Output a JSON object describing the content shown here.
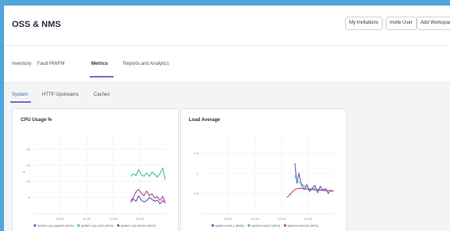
{
  "header": {
    "title": "OSS & NMS",
    "buttons": [
      "My Invitations",
      "Invite User",
      "Add Workspace"
    ]
  },
  "nav": {
    "tabs": [
      "Inventory",
      "Fault PM/FM",
      "Metrics",
      "Reports and Analytics"
    ],
    "active": "Metrics"
  },
  "subnav": {
    "tabs": [
      "System",
      "HTTP Upstreams",
      "Caches"
    ],
    "active": "System"
  },
  "colors": {
    "blue": "#5b5fc7",
    "teal": "#4bbf9f",
    "magenta": "#b4458c",
    "accent": "#6b6fd3",
    "background": "#4fa6d8"
  },
  "chart_data": [
    {
      "type": "line",
      "title": "CPU Usage %",
      "ylabel": "%",
      "ylim": [
        0,
        25
      ],
      "yticks": [
        5,
        10,
        15,
        20
      ],
      "xticks": [
        "10:00",
        "11:20",
        "12:40",
        "14:13"
      ],
      "xlim": [
        0,
        100
      ],
      "series": [
        {
          "name": "system.cpu.system (AVG)",
          "color": "#5b5fc7",
          "x": [
            73,
            75,
            77,
            79,
            81,
            83,
            85,
            87,
            89,
            91,
            93,
            95,
            97,
            99
          ],
          "values": [
            3.5,
            4.5,
            3.8,
            5.5,
            4.2,
            3.6,
            4.0,
            5.0,
            4.4,
            3.8,
            4.2,
            3.0,
            4.0,
            3.4
          ]
        },
        {
          "name": "system.cpu.user (AVG)",
          "color": "#4bbf9f",
          "x": [
            73,
            75,
            77,
            79,
            81,
            83,
            85,
            87,
            89,
            91,
            93,
            95,
            97,
            99
          ],
          "values": [
            11.5,
            12.3,
            11.8,
            13.6,
            12.0,
            11.6,
            12.6,
            11.5,
            12.9,
            12.2,
            11.3,
            12.4,
            14.1,
            10.5
          ]
        },
        {
          "name": "system.cpu.stolen (AVG)",
          "color": "#b4458c",
          "x": [
            73,
            75,
            77,
            79,
            81,
            83,
            85,
            87,
            89,
            91,
            93,
            95,
            97,
            99
          ],
          "values": [
            4.0,
            5.0,
            6.8,
            7.5,
            6.2,
            5.5,
            7.0,
            5.6,
            6.1,
            4.8,
            5.3,
            4.1,
            5.4,
            3.2
          ]
        }
      ]
    },
    {
      "type": "line",
      "title": "Load Average",
      "ylim": [
        0,
        2
      ],
      "yticks": [
        0.5,
        1,
        1.5
      ],
      "xticks": [
        "10:00",
        "11:20",
        "12:40",
        "14:13"
      ],
      "xlim": [
        0,
        100
      ],
      "series": [
        {
          "name": "system.load.1 (AVG)",
          "color": "#5b5fc7",
          "x": [
            70,
            71.5,
            73,
            75,
            77,
            79,
            81,
            83,
            85,
            87,
            89,
            91,
            93,
            95,
            97,
            99
          ],
          "values": [
            1.25,
            0.75,
            1.0,
            0.7,
            0.6,
            0.72,
            0.55,
            0.63,
            0.7,
            0.52,
            0.68,
            0.58,
            0.62,
            0.5,
            0.58,
            0.55
          ]
        },
        {
          "name": "system.load.5 (AVG)",
          "color": "#4bbf9f",
          "x": [
            70,
            71.5,
            73,
            75,
            77,
            79,
            81,
            83,
            85,
            87,
            89,
            91,
            93,
            95,
            97,
            99
          ],
          "values": [
            0.95,
            0.82,
            0.78,
            0.74,
            0.68,
            0.65,
            0.62,
            0.61,
            0.62,
            0.6,
            0.59,
            0.58,
            0.58,
            0.57,
            0.56,
            0.56
          ]
        },
        {
          "name": "system.load.15 (AVG)",
          "color": "#b4458c",
          "x": [
            64,
            66,
            68,
            70,
            72,
            74,
            76,
            78,
            80,
            82,
            84,
            86,
            88,
            90,
            92,
            95,
            99
          ],
          "values": [
            0.4,
            0.46,
            0.54,
            0.6,
            0.62,
            0.63,
            0.62,
            0.61,
            0.6,
            0.6,
            0.59,
            0.59,
            0.58,
            0.58,
            0.57,
            0.57,
            0.56
          ]
        }
      ]
    }
  ]
}
